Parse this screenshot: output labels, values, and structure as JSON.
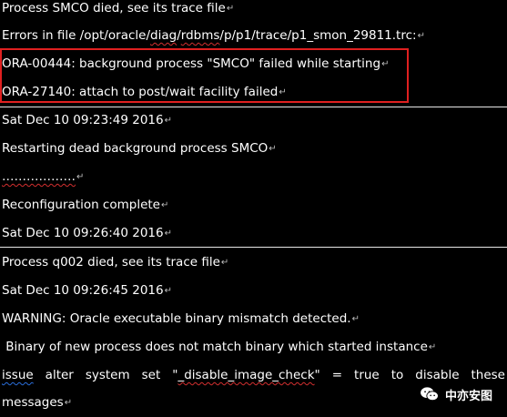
{
  "colors": {
    "background": "#000000",
    "text": "#ffffff",
    "highlight_box": "#e02020",
    "rule": "#e6e6e6"
  },
  "log": {
    "line1": "Process SMCO died, see its trace file",
    "line2_prefix": "Errors in file /opt/oracle/",
    "line2_diag": "diag",
    "line2_mid": "/",
    "line2_rdbms": "rdbms",
    "line2_suffix": "/p/p1/trace/p1_smon_29811.trc:",
    "line3": "ORA-00444: background process \"SMCO\" failed while starting",
    "line4": "ORA-27140: attach to post/wait facility failed",
    "line5": "Sat Dec 10 09:23:49 2016",
    "line6": "Restarting dead background process SMCO",
    "line7": "………………",
    "line8": "Reconfiguration complete",
    "line9": "Sat Dec 10 09:26:40 2016",
    "line10": "Process q002 died, see its trace file",
    "line11": "Sat Dec 10 09:26:45 2016",
    "line12": "WARNING: Oracle executable binary mismatch detected.",
    "line13": " Binary of new process does not match binary which started instance",
    "line14_issue": "issue",
    "line14_mid": " alter system set \"",
    "line14_param": "_disable_image_check",
    "line14_end": "\" = true to disable these",
    "line15": "messages"
  },
  "watermark": {
    "icon": "wechat-icon",
    "label": "中亦安图"
  }
}
